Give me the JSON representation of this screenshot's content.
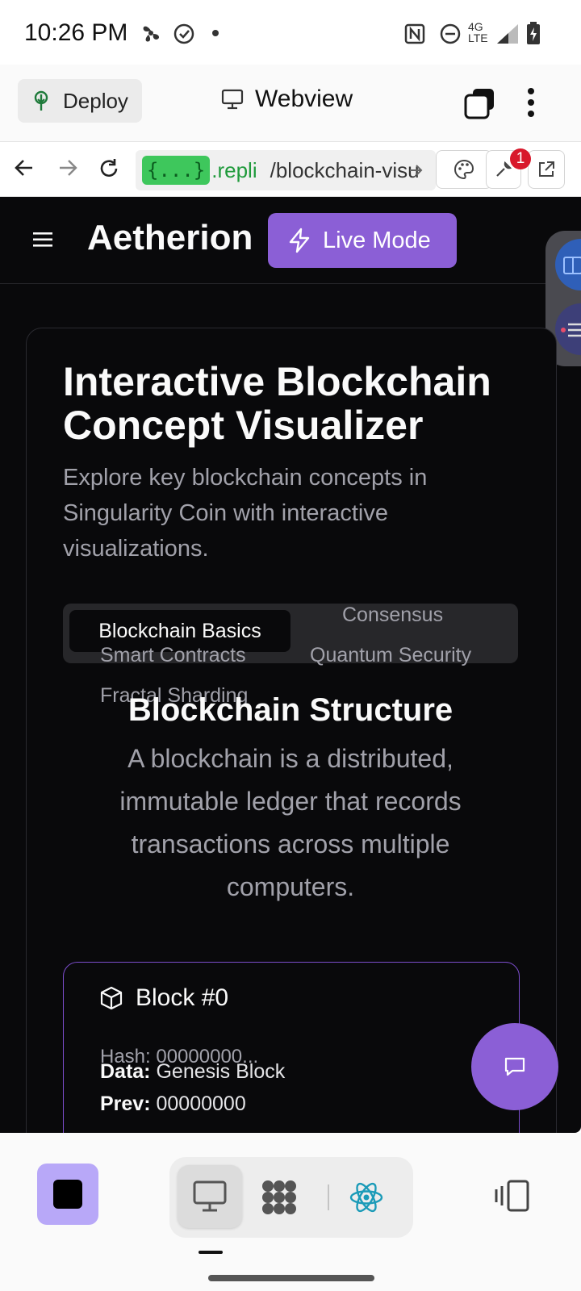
{
  "status_bar": {
    "time": "10:26 PM",
    "network": "4G LTE",
    "icons": [
      "fan-icon",
      "check-circle-icon",
      "dot-icon",
      "nfc-icon",
      "dnd-icon",
      "signal-icon",
      "battery-icon"
    ]
  },
  "header": {
    "deploy_label": "Deploy",
    "webview_label": "Webview"
  },
  "url_bar": {
    "badge": "{...}",
    "host": ".repli",
    "path": "/blockchain-visu",
    "devtools_badge": "1"
  },
  "app": {
    "brand": "Aetherion",
    "live_mode_label": "Live Mode",
    "card": {
      "title": "Interactive Blockchain Concept Visualizer",
      "description": "Explore key blockchain concepts in Singularity Coin with interactive visualizations."
    },
    "tabs": [
      {
        "label": "Blockchain Basics",
        "active": true
      },
      {
        "label": "Consensus",
        "active": false
      },
      {
        "label": "Smart Contracts",
        "active": false
      },
      {
        "label": "Quantum Security",
        "active": false
      },
      {
        "label": "Fractal Sharding",
        "active": false
      }
    ],
    "section": {
      "title": "Blockchain Structure",
      "description": "A blockchain is a distributed, immutable ledger that records transactions across multiple computers."
    },
    "block": {
      "title": "Block #0",
      "hash": "Hash: 00000000...",
      "data_label": "Data:",
      "data_value": "Genesis Block",
      "prev_label": "Prev:",
      "prev_value": "00000000"
    }
  },
  "colors": {
    "accent": "#8b5fd6",
    "app_bg": "#09090b",
    "muted_text": "#a1a1aa",
    "stop_button": "#b8a8f8"
  }
}
